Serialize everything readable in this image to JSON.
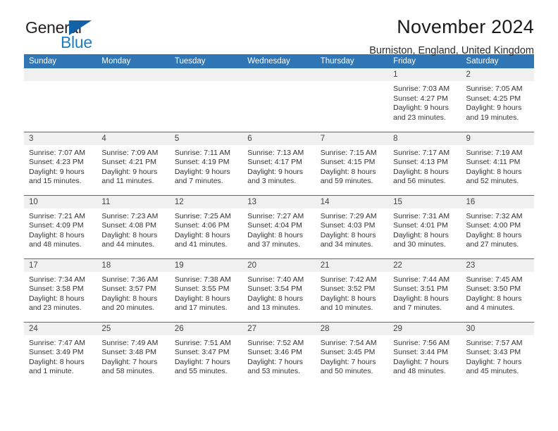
{
  "logo": {
    "word1": "General",
    "word2": "Blue",
    "triangle_color": "#1362a8",
    "blue_color": "#1b7fc4"
  },
  "header": {
    "title": "November 2024",
    "location": "Burniston, England, United Kingdom"
  },
  "colors": {
    "header_blue": "#3075b4",
    "daynum_band": "#f0f0f0",
    "text": "#333333"
  },
  "weekdays": [
    "Sunday",
    "Monday",
    "Tuesday",
    "Wednesday",
    "Thursday",
    "Friday",
    "Saturday"
  ],
  "labels": {
    "sunrise": "Sunrise:",
    "sunset": "Sunset:",
    "daylight": "Daylight:"
  },
  "weeks": [
    [
      {
        "day": "",
        "empty": true
      },
      {
        "day": "",
        "empty": true
      },
      {
        "day": "",
        "empty": true
      },
      {
        "day": "",
        "empty": true
      },
      {
        "day": "",
        "empty": true
      },
      {
        "day": "1",
        "sunrise": "Sunrise: 7:03 AM",
        "sunset": "Sunset: 4:27 PM",
        "daylight1": "Daylight: 9 hours",
        "daylight2": "and 23 minutes."
      },
      {
        "day": "2",
        "sunrise": "Sunrise: 7:05 AM",
        "sunset": "Sunset: 4:25 PM",
        "daylight1": "Daylight: 9 hours",
        "daylight2": "and 19 minutes."
      }
    ],
    [
      {
        "day": "3",
        "sunrise": "Sunrise: 7:07 AM",
        "sunset": "Sunset: 4:23 PM",
        "daylight1": "Daylight: 9 hours",
        "daylight2": "and 15 minutes."
      },
      {
        "day": "4",
        "sunrise": "Sunrise: 7:09 AM",
        "sunset": "Sunset: 4:21 PM",
        "daylight1": "Daylight: 9 hours",
        "daylight2": "and 11 minutes."
      },
      {
        "day": "5",
        "sunrise": "Sunrise: 7:11 AM",
        "sunset": "Sunset: 4:19 PM",
        "daylight1": "Daylight: 9 hours",
        "daylight2": "and 7 minutes."
      },
      {
        "day": "6",
        "sunrise": "Sunrise: 7:13 AM",
        "sunset": "Sunset: 4:17 PM",
        "daylight1": "Daylight: 9 hours",
        "daylight2": "and 3 minutes."
      },
      {
        "day": "7",
        "sunrise": "Sunrise: 7:15 AM",
        "sunset": "Sunset: 4:15 PM",
        "daylight1": "Daylight: 8 hours",
        "daylight2": "and 59 minutes."
      },
      {
        "day": "8",
        "sunrise": "Sunrise: 7:17 AM",
        "sunset": "Sunset: 4:13 PM",
        "daylight1": "Daylight: 8 hours",
        "daylight2": "and 56 minutes."
      },
      {
        "day": "9",
        "sunrise": "Sunrise: 7:19 AM",
        "sunset": "Sunset: 4:11 PM",
        "daylight1": "Daylight: 8 hours",
        "daylight2": "and 52 minutes."
      }
    ],
    [
      {
        "day": "10",
        "sunrise": "Sunrise: 7:21 AM",
        "sunset": "Sunset: 4:09 PM",
        "daylight1": "Daylight: 8 hours",
        "daylight2": "and 48 minutes."
      },
      {
        "day": "11",
        "sunrise": "Sunrise: 7:23 AM",
        "sunset": "Sunset: 4:08 PM",
        "daylight1": "Daylight: 8 hours",
        "daylight2": "and 44 minutes."
      },
      {
        "day": "12",
        "sunrise": "Sunrise: 7:25 AM",
        "sunset": "Sunset: 4:06 PM",
        "daylight1": "Daylight: 8 hours",
        "daylight2": "and 41 minutes."
      },
      {
        "day": "13",
        "sunrise": "Sunrise: 7:27 AM",
        "sunset": "Sunset: 4:04 PM",
        "daylight1": "Daylight: 8 hours",
        "daylight2": "and 37 minutes."
      },
      {
        "day": "14",
        "sunrise": "Sunrise: 7:29 AM",
        "sunset": "Sunset: 4:03 PM",
        "daylight1": "Daylight: 8 hours",
        "daylight2": "and 34 minutes."
      },
      {
        "day": "15",
        "sunrise": "Sunrise: 7:31 AM",
        "sunset": "Sunset: 4:01 PM",
        "daylight1": "Daylight: 8 hours",
        "daylight2": "and 30 minutes."
      },
      {
        "day": "16",
        "sunrise": "Sunrise: 7:32 AM",
        "sunset": "Sunset: 4:00 PM",
        "daylight1": "Daylight: 8 hours",
        "daylight2": "and 27 minutes."
      }
    ],
    [
      {
        "day": "17",
        "sunrise": "Sunrise: 7:34 AM",
        "sunset": "Sunset: 3:58 PM",
        "daylight1": "Daylight: 8 hours",
        "daylight2": "and 23 minutes."
      },
      {
        "day": "18",
        "sunrise": "Sunrise: 7:36 AM",
        "sunset": "Sunset: 3:57 PM",
        "daylight1": "Daylight: 8 hours",
        "daylight2": "and 20 minutes."
      },
      {
        "day": "19",
        "sunrise": "Sunrise: 7:38 AM",
        "sunset": "Sunset: 3:55 PM",
        "daylight1": "Daylight: 8 hours",
        "daylight2": "and 17 minutes."
      },
      {
        "day": "20",
        "sunrise": "Sunrise: 7:40 AM",
        "sunset": "Sunset: 3:54 PM",
        "daylight1": "Daylight: 8 hours",
        "daylight2": "and 13 minutes."
      },
      {
        "day": "21",
        "sunrise": "Sunrise: 7:42 AM",
        "sunset": "Sunset: 3:52 PM",
        "daylight1": "Daylight: 8 hours",
        "daylight2": "and 10 minutes."
      },
      {
        "day": "22",
        "sunrise": "Sunrise: 7:44 AM",
        "sunset": "Sunset: 3:51 PM",
        "daylight1": "Daylight: 8 hours",
        "daylight2": "and 7 minutes."
      },
      {
        "day": "23",
        "sunrise": "Sunrise: 7:45 AM",
        "sunset": "Sunset: 3:50 PM",
        "daylight1": "Daylight: 8 hours",
        "daylight2": "and 4 minutes."
      }
    ],
    [
      {
        "day": "24",
        "sunrise": "Sunrise: 7:47 AM",
        "sunset": "Sunset: 3:49 PM",
        "daylight1": "Daylight: 8 hours",
        "daylight2": "and 1 minute."
      },
      {
        "day": "25",
        "sunrise": "Sunrise: 7:49 AM",
        "sunset": "Sunset: 3:48 PM",
        "daylight1": "Daylight: 7 hours",
        "daylight2": "and 58 minutes."
      },
      {
        "day": "26",
        "sunrise": "Sunrise: 7:51 AM",
        "sunset": "Sunset: 3:47 PM",
        "daylight1": "Daylight: 7 hours",
        "daylight2": "and 55 minutes."
      },
      {
        "day": "27",
        "sunrise": "Sunrise: 7:52 AM",
        "sunset": "Sunset: 3:46 PM",
        "daylight1": "Daylight: 7 hours",
        "daylight2": "and 53 minutes."
      },
      {
        "day": "28",
        "sunrise": "Sunrise: 7:54 AM",
        "sunset": "Sunset: 3:45 PM",
        "daylight1": "Daylight: 7 hours",
        "daylight2": "and 50 minutes."
      },
      {
        "day": "29",
        "sunrise": "Sunrise: 7:56 AM",
        "sunset": "Sunset: 3:44 PM",
        "daylight1": "Daylight: 7 hours",
        "daylight2": "and 48 minutes."
      },
      {
        "day": "30",
        "sunrise": "Sunrise: 7:57 AM",
        "sunset": "Sunset: 3:43 PM",
        "daylight1": "Daylight: 7 hours",
        "daylight2": "and 45 minutes."
      }
    ]
  ]
}
